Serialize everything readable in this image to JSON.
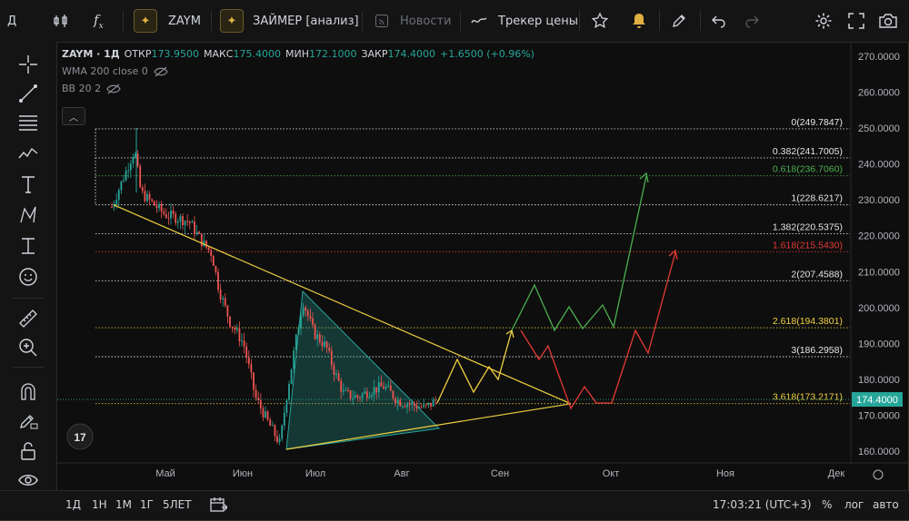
{
  "topbar": {
    "menu_letter": "Д",
    "symbol": "ZAYM",
    "analysis_title": "ЗАЙМЕР [анализ]",
    "news_label": "Новости",
    "price_tracker_label": "Трекер цены"
  },
  "legend": {
    "symbol_tf": "ZAYM · 1Д",
    "open_label": "ОТКР",
    "open": "173.9500",
    "high_label": "МАКС",
    "high": "175.4000",
    "low_label": "МИН",
    "low": "172.1000",
    "close_label": "ЗАКР",
    "close": "174.4000",
    "change": "+1.6500 (+0.96%)",
    "indicator1": "WMA 200 close 0",
    "indicator2": "BB 20 2"
  },
  "price_axis": [
    "270.0000",
    "260.0000",
    "250.0000",
    "240.0000",
    "230.0000",
    "220.0000",
    "210.0000",
    "200.0000",
    "190.0000",
    "180.0000",
    "170.0000",
    "160.0000"
  ],
  "current_price": "174.4000",
  "time_axis": [
    "Май",
    "Июн",
    "Июл",
    "Авг",
    "Сен",
    "Окт",
    "Ноя",
    "Дек"
  ],
  "fib_levels": [
    {
      "label": "0(249.7847)",
      "price": 249.7847,
      "color": "#e6e6e6"
    },
    {
      "label": "0.382(241.7005)",
      "price": 241.7005,
      "color": "#e6e6e6"
    },
    {
      "label": "0.618(236.7060)",
      "price": 236.706,
      "color": "#4caf50"
    },
    {
      "label": "1(228.6217)",
      "price": 228.6217,
      "color": "#e6e6e6"
    },
    {
      "label": "1.382(220.5375)",
      "price": 220.5375,
      "color": "#e6e6e6"
    },
    {
      "label": "1.618(215.5430)",
      "price": 215.543,
      "color": "#e53935"
    },
    {
      "label": "2(207.4588)",
      "price": 207.4588,
      "color": "#e6e6e6"
    },
    {
      "label": "2.618(194.3801)",
      "price": 194.3801,
      "color": "#f0d040"
    },
    {
      "label": "3(186.2958)",
      "price": 186.2958,
      "color": "#e6e6e6"
    },
    {
      "label": "3.618(173.2171)",
      "price": 173.2171,
      "color": "#f0d040"
    }
  ],
  "bottombar": {
    "timeframes": [
      "1Д",
      "1Н",
      "1М",
      "1Г",
      "5ЛЕТ"
    ],
    "clock": "17:03:21 (UTC+3)",
    "percent": "%",
    "log": "лог",
    "auto": "авто"
  },
  "colors": {
    "up": "#26a69a",
    "down": "#ef5350",
    "bull_path": "#4caf50",
    "bear_path": "#e53935",
    "trend": "#f0d040",
    "accent": "#e0b040"
  }
}
